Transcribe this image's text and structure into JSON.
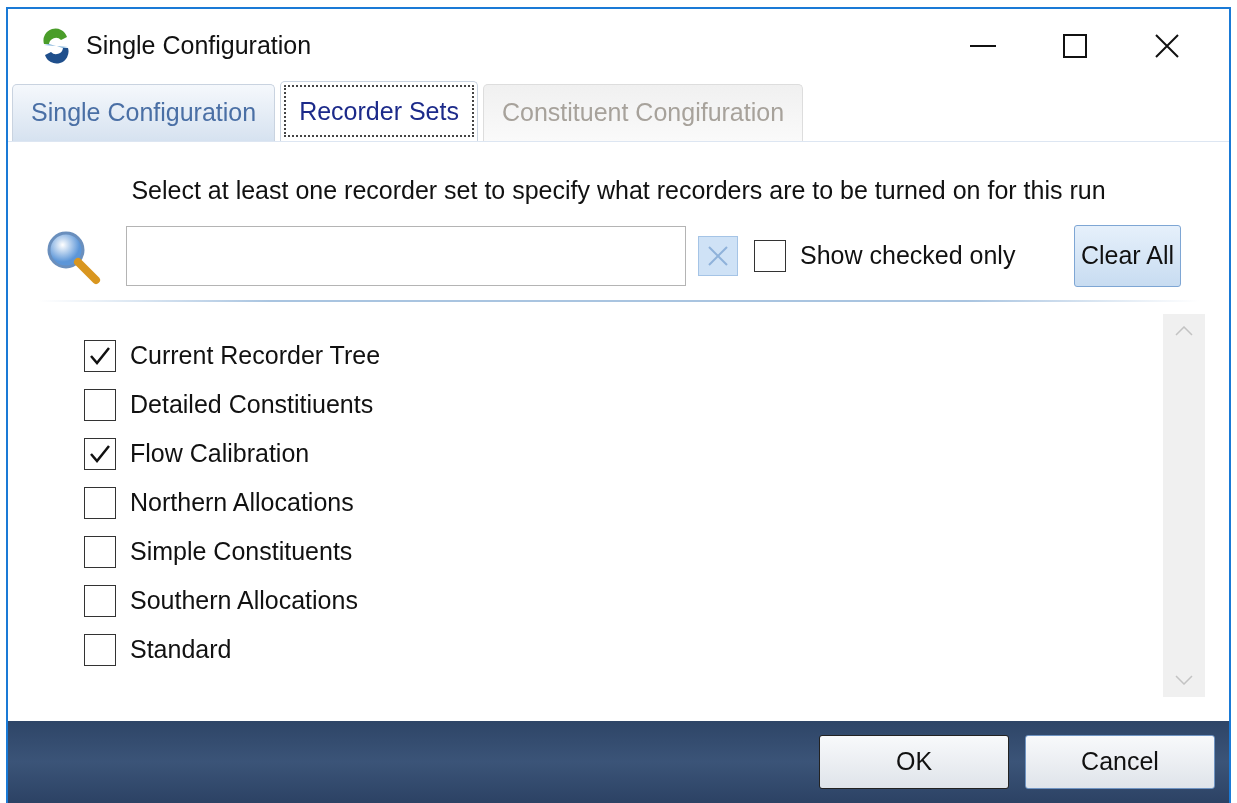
{
  "window": {
    "title": "Single Configuration"
  },
  "tabs": [
    {
      "label": "Single Configuration",
      "selected": false,
      "disabled": false
    },
    {
      "label": "Recorder Sets",
      "selected": true,
      "disabled": false
    },
    {
      "label": "Constituent Congifuration",
      "selected": false,
      "disabled": true
    }
  ],
  "instruction": "Select at least one recorder set to specify what recorders are to be turned on for this run",
  "show_checked_only": {
    "label": "Show checked only",
    "checked": false
  },
  "clear_all_button": "Clear All",
  "recorder_sets": [
    {
      "label": "Current Recorder Tree",
      "checked": true
    },
    {
      "label": "Detailed Constitiuents",
      "checked": false
    },
    {
      "label": "Flow Calibration",
      "checked": true
    },
    {
      "label": "Northern Allocations",
      "checked": false
    },
    {
      "label": "Simple Constituents",
      "checked": false
    },
    {
      "label": "Southern Allocations",
      "checked": false
    },
    {
      "label": "Standard",
      "checked": false
    }
  ],
  "buttons": [
    "OK",
    "Cancel"
  ]
}
